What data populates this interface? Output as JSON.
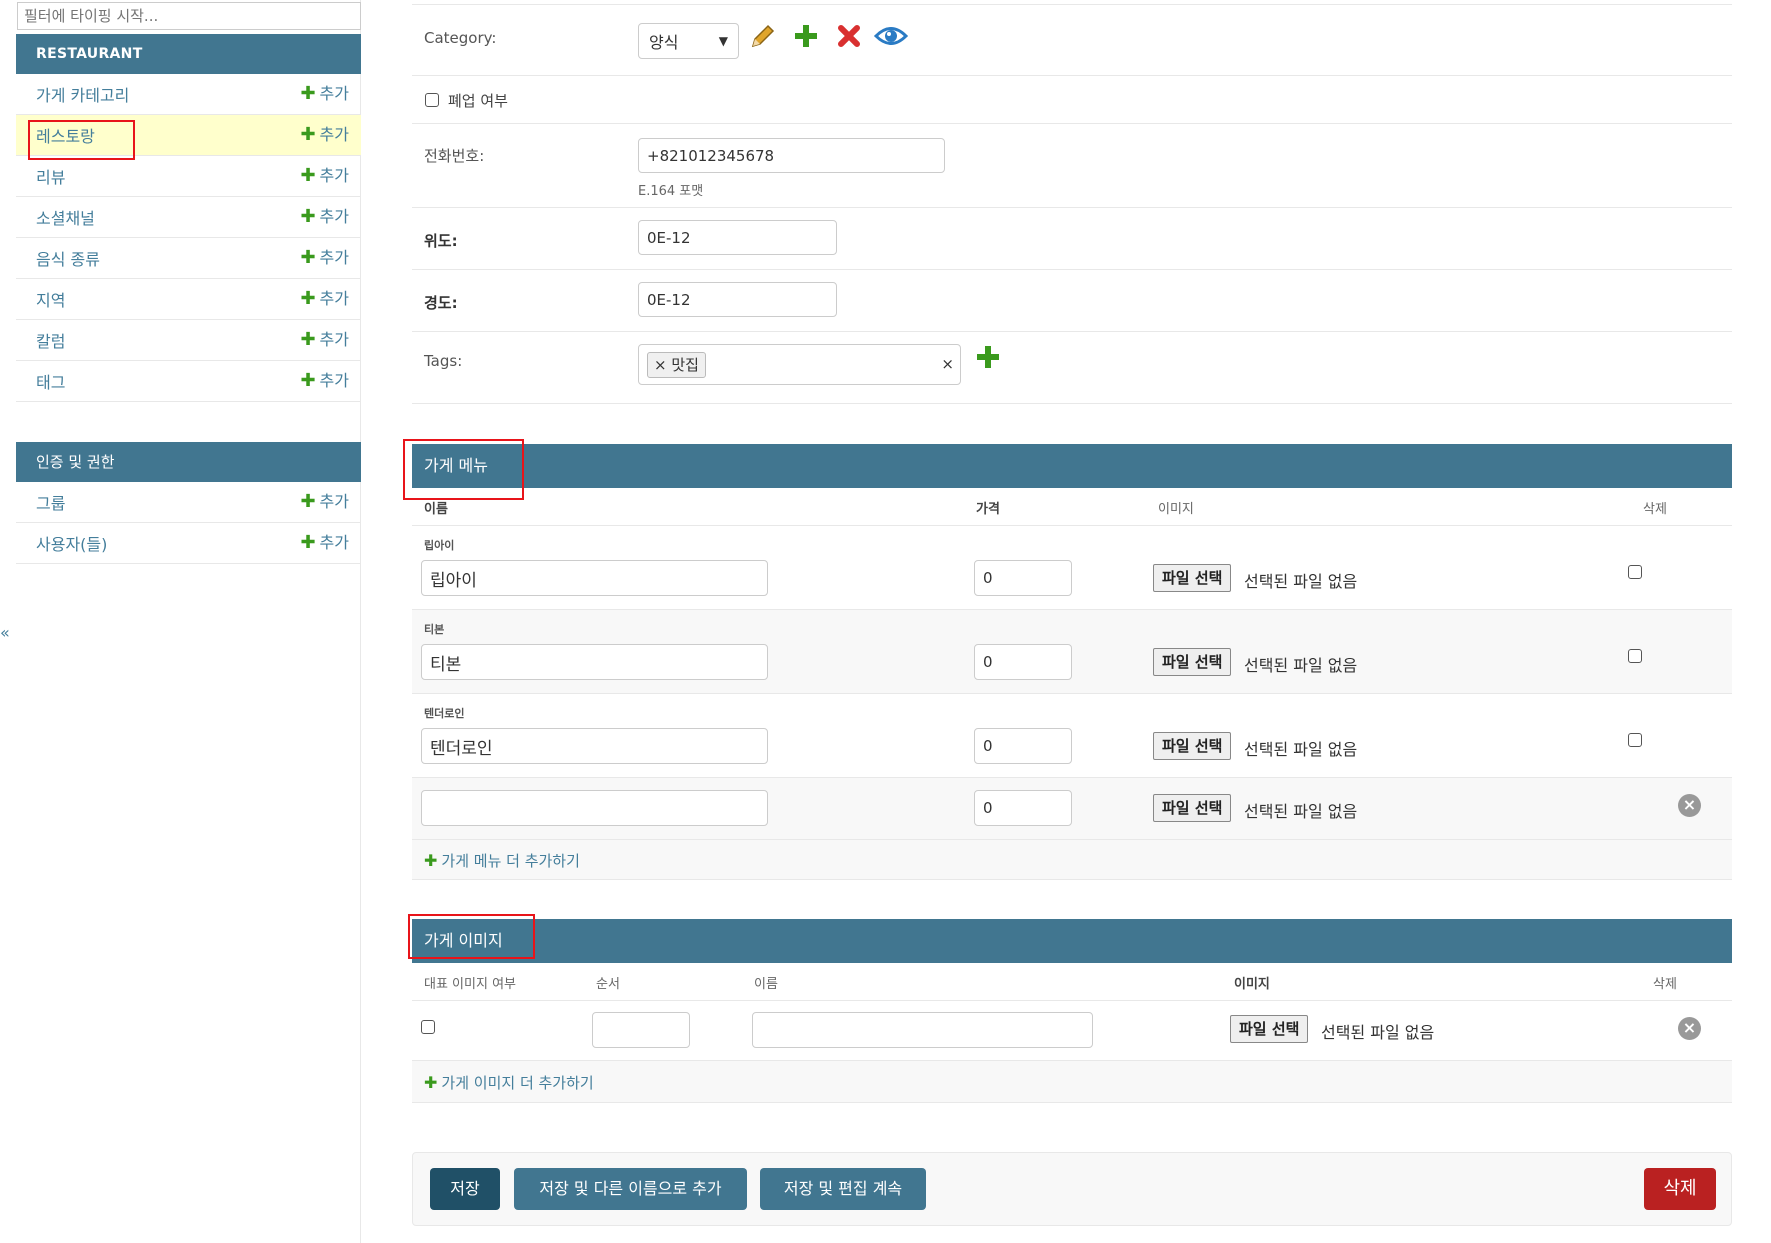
{
  "sidebar": {
    "filter_placeholder": "필터에 타이핑 시작...",
    "modules": [
      {
        "title": "RESTAURANT",
        "items": [
          {
            "label": "가게 카테고리",
            "add": "추가"
          },
          {
            "label": "레스토랑",
            "add": "추가"
          },
          {
            "label": "리뷰",
            "add": "추가"
          },
          {
            "label": "소셜채널",
            "add": "추가"
          },
          {
            "label": "음식 종류",
            "add": "추가"
          },
          {
            "label": "지역",
            "add": "추가"
          },
          {
            "label": "칼럼",
            "add": "추가"
          },
          {
            "label": "태그",
            "add": "추가"
          }
        ]
      },
      {
        "title": "인증 및 권한",
        "items": [
          {
            "label": "그룹",
            "add": "추가"
          },
          {
            "label": "사용자(들)",
            "add": "추가"
          }
        ]
      }
    ],
    "collapse_glyph": "«"
  },
  "form": {
    "category": {
      "label": "Category:",
      "value": "양식"
    },
    "closed": {
      "label": "폐업 여부"
    },
    "phone": {
      "label": "전화번호:",
      "value": "+821012345678",
      "help": "E.164 포맷"
    },
    "latitude": {
      "label": "위도:",
      "value": "0E-12"
    },
    "longitude": {
      "label": "경도:",
      "value": "0E-12"
    },
    "tags": {
      "label": "Tags:",
      "chip": "맛집",
      "chip_remove": "×",
      "clear": "×"
    }
  },
  "menu_inline": {
    "title": "가게 메뉴",
    "columns": {
      "name": "이름",
      "price": "가격",
      "image": "이미지",
      "delete": "삭제"
    },
    "rows": [
      {
        "title": "립아이",
        "name": "립아이",
        "price": "0",
        "file_button": "파일 선택",
        "file_status": "선택된 파일 없음"
      },
      {
        "title": "티본",
        "name": "티본",
        "price": "0",
        "file_button": "파일 선택",
        "file_status": "선택된 파일 없음"
      },
      {
        "title": "텐더로인",
        "name": "텐더로인",
        "price": "0",
        "file_button": "파일 선택",
        "file_status": "선택된 파일 없음"
      },
      {
        "title": "",
        "name": "",
        "price": "0",
        "file_button": "파일 선택",
        "file_status": "선택된 파일 없음"
      }
    ],
    "add_more": "가게 메뉴 더 추가하기"
  },
  "image_inline": {
    "title": "가게 이미지",
    "columns": {
      "is_main": "대표 이미지 여부",
      "order": "순서",
      "name": "이름",
      "image": "이미지",
      "delete": "삭제"
    },
    "row": {
      "order": "",
      "name": "",
      "file_button": "파일 선택",
      "file_status": "선택된 파일 없음"
    },
    "add_more": "가게 이미지 더 추가하기"
  },
  "actions": {
    "save": "저장",
    "save_add_another": "저장 및 다른 이름으로 추가",
    "save_continue": "저장 및 편집 계속",
    "delete": "삭제"
  },
  "colors": {
    "header_blue": "#417690",
    "link_blue": "#447e9b",
    "add_green": "#3a9a1d",
    "delete_red": "#ba2121",
    "selected_yellow": "#ffffcc",
    "highlight_red": "#e8141a"
  }
}
